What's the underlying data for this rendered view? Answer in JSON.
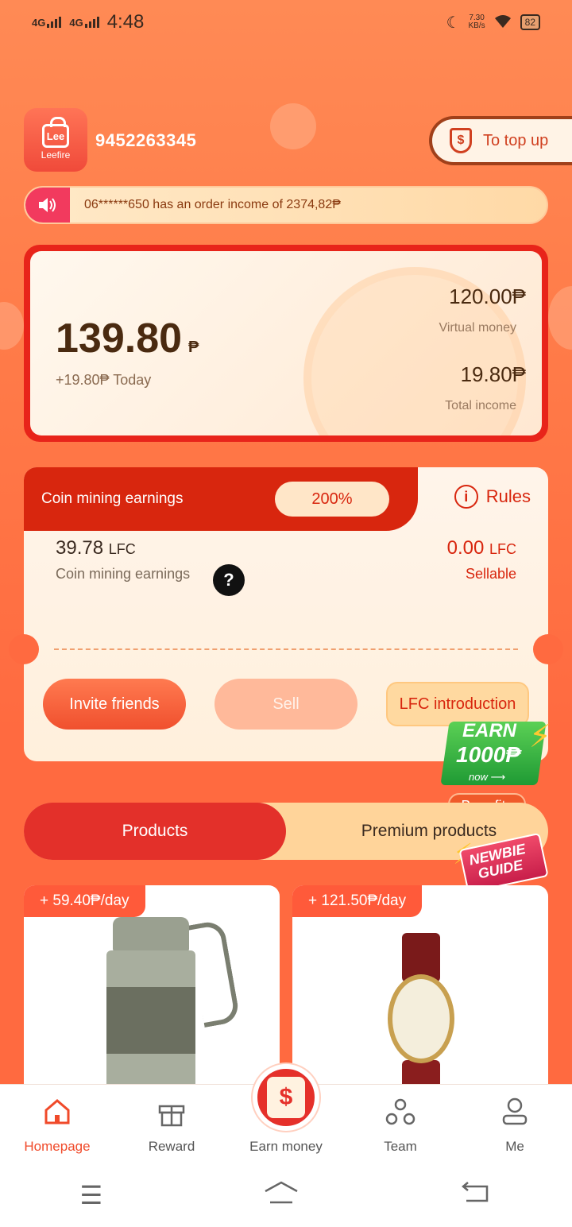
{
  "status": {
    "time": "4:48",
    "net1": "4G",
    "net2": "4G",
    "speed_value": "7.30",
    "speed_unit": "KB/s",
    "battery": "82"
  },
  "header": {
    "logo_text": "Lee",
    "logo_brand": "Leefire",
    "user_id": "9452263345",
    "topup_label": "To top up",
    "topup_icon": "$"
  },
  "marquee": {
    "text": "06******650 has an order income of 2374,82₱"
  },
  "balance": {
    "amount": "139.80",
    "currency": "₱",
    "today": "+19.80₱ Today",
    "virtual_value": "120.00₱",
    "virtual_label": "Virtual money",
    "total_value": "19.80₱",
    "total_label": "Total income"
  },
  "mining": {
    "tab_label": "Coin mining earnings",
    "percent": "200%",
    "rules_label": "Rules",
    "rules_icon": "i",
    "lfc_amount": "39.78",
    "lfc_unit": "LFC",
    "lfc_label": "Coin mining earnings",
    "help_icon": "?",
    "sellable_amount": "0.00",
    "sellable_unit": "LFC",
    "sellable_label": "Sellable",
    "invite_label": "Invite friends",
    "sell_label": "Sell",
    "intro_label": "LFC introduction"
  },
  "promo": {
    "earn_line1": "EARN",
    "earn_line2": "1000₱",
    "earn_line3": "now ⟶",
    "benefits": "Benefits",
    "newbie_line1": "NEWBIE",
    "newbie_line2": "GUIDE"
  },
  "segments": {
    "active": "Products",
    "inactive": "Premium products"
  },
  "products": [
    {
      "tag": "+ 59.40₱/day"
    },
    {
      "tag": "+ 121.50₱/day"
    }
  ],
  "tabbar": {
    "home": "Homepage",
    "reward": "Reward",
    "earn": "Earn money",
    "team": "Team",
    "me": "Me",
    "earn_icon": "$"
  },
  "colors": {
    "accent": "#e3302a",
    "brand_orange": "#ff6a40",
    "highlight": "#ffd49a"
  }
}
